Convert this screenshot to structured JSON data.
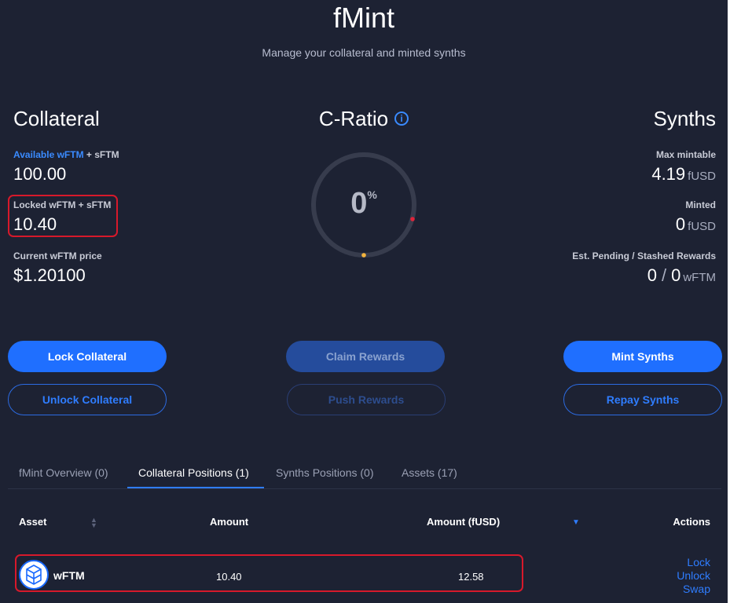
{
  "header": {
    "title": "fMint",
    "subtitle": "Manage your collateral and minted synths"
  },
  "collateral": {
    "heading": "Collateral",
    "available_label_blue": "Available wFTM",
    "available_label_rest": " + sFTM",
    "available_value": "100.00",
    "locked_label": "Locked wFTM + sFTM",
    "locked_value": "10.40",
    "price_label": "Current wFTM price",
    "price_value": "$1.20100"
  },
  "ratio": {
    "heading": "C-Ratio",
    "info_glyph": "i",
    "value": "0",
    "value_unit": "%"
  },
  "synths": {
    "heading": "Synths",
    "max_label": "Max mintable",
    "max_value": "4.19",
    "max_unit": "fUSD",
    "minted_label": "Minted",
    "minted_value": "0",
    "minted_unit": "fUSD",
    "rewards_label": "Est. Pending / Stashed Rewards",
    "rewards_pending": "0",
    "rewards_sep": "/",
    "rewards_stashed": "0",
    "rewards_unit": "wFTM"
  },
  "buttons": {
    "lock": "Lock Collateral",
    "unlock": "Unlock Collateral",
    "claim": "Claim Rewards",
    "push": "Push Rewards",
    "mint": "Mint Synths",
    "repay": "Repay Synths"
  },
  "tabs": [
    {
      "label": "fMint Overview",
      "count": "(0)"
    },
    {
      "label": "Collateral Positions",
      "count": "(1)"
    },
    {
      "label": "Synths Positions",
      "count": "(0)"
    },
    {
      "label": "Assets",
      "count": "(17)"
    }
  ],
  "table": {
    "headers": {
      "asset": "Asset",
      "amount": "Amount",
      "amount_fusd": "Amount (fUSD)",
      "actions": "Actions"
    },
    "rows": [
      {
        "asset": "wFTM",
        "amount": "10.40",
        "amount_fusd": "12.58",
        "actions": [
          "Lock",
          "Unlock",
          "Swap"
        ]
      }
    ]
  },
  "colors": {
    "background": "#1d2233",
    "accent": "#1f6fff",
    "highlight": "#d7192b"
  }
}
